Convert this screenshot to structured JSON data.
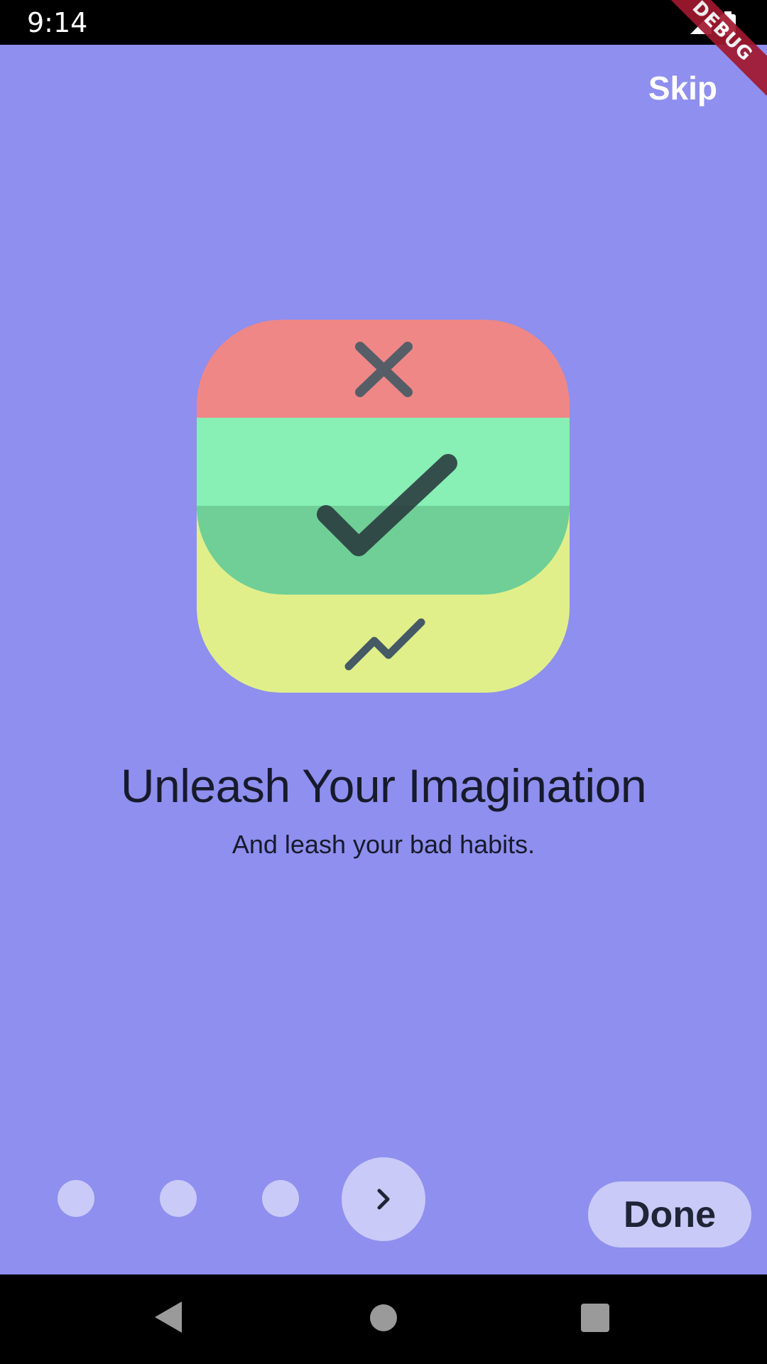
{
  "status_bar": {
    "time": "9:14",
    "debug_label": "DEBUG",
    "icons": [
      "signal-icon",
      "battery-icon"
    ]
  },
  "header": {
    "skip_label": "Skip"
  },
  "hero": {
    "icon_name": "habit-tracker-app-icon",
    "colors": {
      "top_band": "#ef8787",
      "middle_band": "#88efb5",
      "bottom_band": "#e1ef8a",
      "glyph": "#455a64"
    }
  },
  "content": {
    "title": "Unleash Your Imagination",
    "subtitle": "And leash your bad habits."
  },
  "pager": {
    "page_count": 4,
    "current_page": 4,
    "next_icon": "chevron-right-icon"
  },
  "footer": {
    "done_label": "Done"
  },
  "nav_bar": {
    "icons": [
      "back-icon",
      "home-icon",
      "recents-icon"
    ]
  },
  "colors": {
    "background": "#8e8fee",
    "button_fill": "#c9caf8",
    "text_dark": "#171a2b"
  }
}
